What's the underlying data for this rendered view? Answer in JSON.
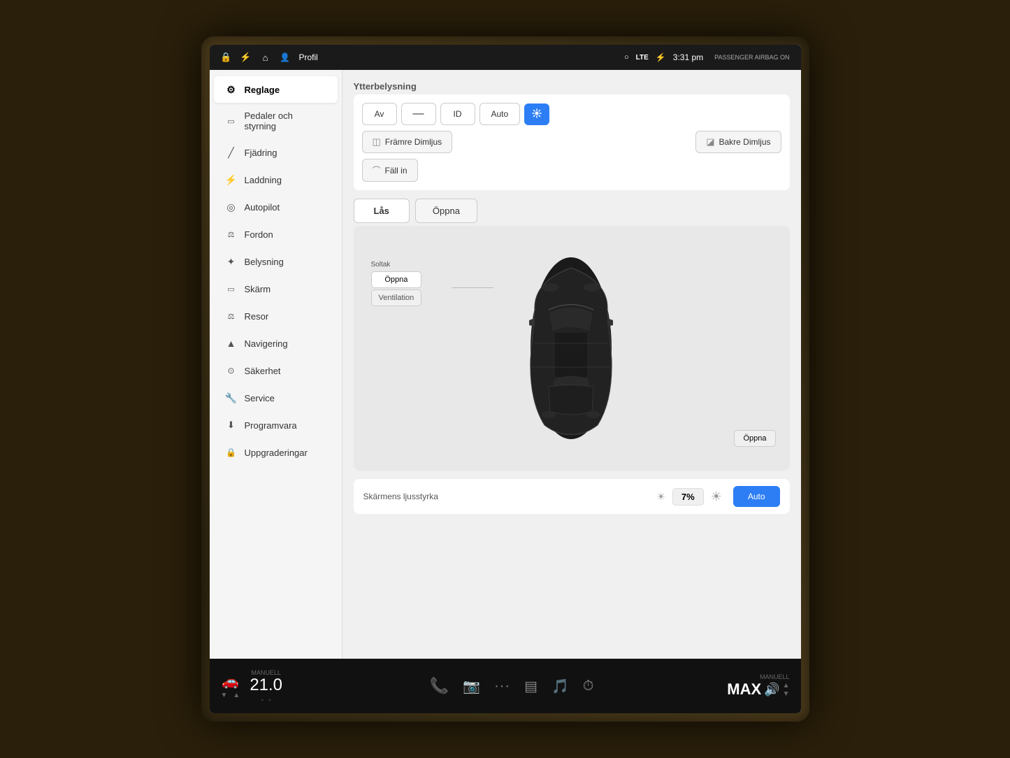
{
  "statusBar": {
    "icons": [
      "lock-icon",
      "lightning-icon",
      "home-icon",
      "person-icon"
    ],
    "profileLabel": "Profil",
    "signal": "LTE",
    "bluetooth": "BT",
    "time": "3:31 pm",
    "passenger": "PASSENGER AIRBAG ON"
  },
  "sidebar": {
    "items": [
      {
        "id": "reglage",
        "label": "Reglage",
        "icon": "⚙",
        "active": true
      },
      {
        "id": "pedaler",
        "label": "Pedaler och styrning",
        "icon": "🪑",
        "active": false
      },
      {
        "id": "fjadring",
        "label": "Fjädring",
        "icon": "🔧",
        "active": false
      },
      {
        "id": "laddning",
        "label": "Laddning",
        "icon": "⚡",
        "active": false
      },
      {
        "id": "autopilot",
        "label": "Autopilot",
        "icon": "◎",
        "active": false
      },
      {
        "id": "fordon",
        "label": "Fordon",
        "icon": "⚖",
        "active": false
      },
      {
        "id": "belysning",
        "label": "Belysning",
        "icon": "☀",
        "active": false
      },
      {
        "id": "skarm",
        "label": "Skärm",
        "icon": "🖥",
        "active": false
      },
      {
        "id": "resor",
        "label": "Resor",
        "icon": "📊",
        "active": false
      },
      {
        "id": "navigering",
        "label": "Navigering",
        "icon": "▲",
        "active": false
      },
      {
        "id": "sakerhet",
        "label": "Säkerhet",
        "icon": "🕐",
        "active": false
      },
      {
        "id": "service",
        "label": "Service",
        "icon": "🔑",
        "active": false
      },
      {
        "id": "programvara",
        "label": "Programvara",
        "icon": "⬇",
        "active": false
      },
      {
        "id": "uppgraderingar",
        "label": "Uppgraderingar",
        "icon": "🔒",
        "active": false
      }
    ]
  },
  "content": {
    "sectionTitle": "Ytterbelysning",
    "lightButtons": [
      "Av",
      "—",
      "ID",
      "Auto"
    ],
    "activeLight": "Auto",
    "activeLightExtra": true,
    "fogFront": "Främre Dimljus",
    "fogBack": "Bakre Dimljus",
    "fallIn": "Fäll in",
    "lockBtn": "Lås",
    "openBtn": "Öppna",
    "sunroofLabel": "Soltak",
    "sunroofOpen": "Öppna",
    "ventilation": "Ventilation",
    "openBottom": "Öppna",
    "chargeIcon": "⚡",
    "brightnessTitle": "Skärmens ljusstyrka",
    "brightnessValue": "7%",
    "brightnessAuto": "Auto"
  },
  "taskbar": {
    "manuell": "Manuell",
    "temperature": "21.0",
    "tempUnit": "",
    "phoneIcon": "📞",
    "cameraIcon": "📷",
    "dotsIcon": "···",
    "menuIcon": "▤",
    "spotifyIcon": "Spotify",
    "timerIcon": "⏱",
    "volumeMax": "MAX",
    "volumeIcon": "🔊",
    "manuellVol": "Manuell"
  }
}
